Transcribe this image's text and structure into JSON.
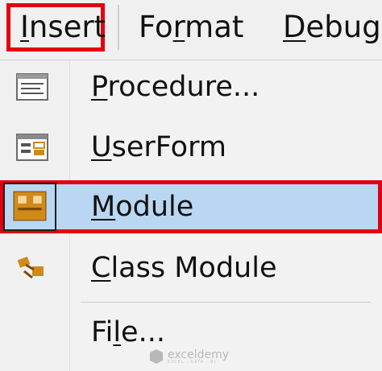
{
  "menubar": {
    "items": [
      {
        "label_first": "I",
        "label_rest": "nsert"
      },
      {
        "label_start": "Fo",
        "label_underlined": "r",
        "label_end": "mat"
      },
      {
        "label_first": "D",
        "label_rest": "ebug"
      }
    ]
  },
  "insert_menu": {
    "items": [
      {
        "underlined": "P",
        "rest": "rocedure...",
        "icon": "procedure-icon"
      },
      {
        "underlined": "U",
        "rest": "serForm",
        "icon": "userform-icon"
      },
      {
        "underlined": "M",
        "rest": "odule",
        "icon": "module-icon",
        "selected": true
      },
      {
        "underlined": "C",
        "rest": "lass Module",
        "icon": "class-module-icon"
      },
      {
        "start": "Fi",
        "underlined": "l",
        "rest": "e..."
      }
    ]
  },
  "watermark": {
    "text": "exceldemy",
    "subtext": "EXCEL · DATA · BI"
  },
  "colors": {
    "highlight": "#e3000f",
    "selection": "#b9d7f2",
    "icon_orange": "#d08a1a"
  }
}
